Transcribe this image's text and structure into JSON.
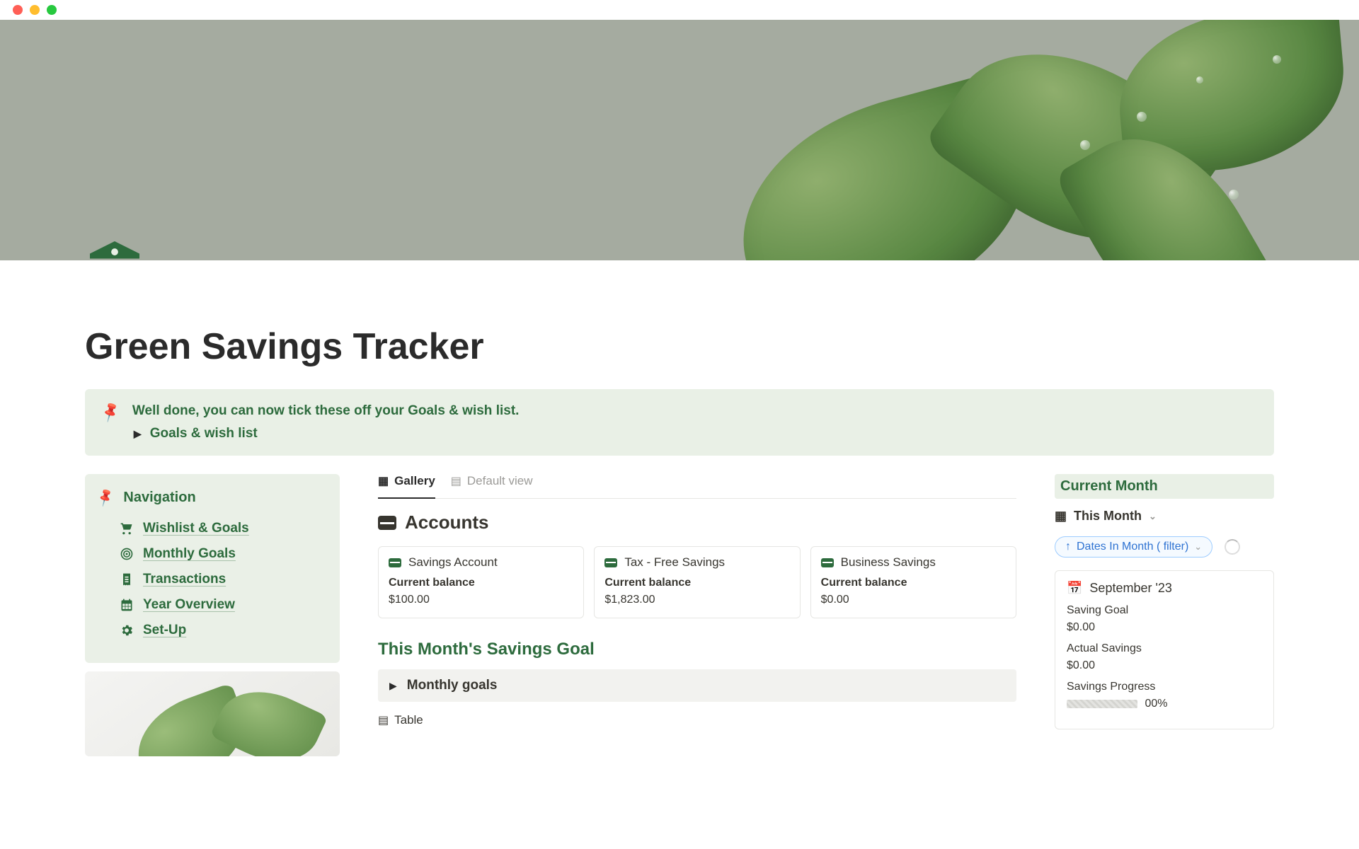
{
  "page": {
    "title": "Green Savings Tracker"
  },
  "callout": {
    "message": "Well done, you can now tick these off your Goals & wish list.",
    "toggle_label": "Goals & wish list"
  },
  "nav": {
    "title": "Navigation",
    "items": [
      {
        "icon": "cart",
        "label": "Wishlist & Goals"
      },
      {
        "icon": "target",
        "label": "Monthly Goals"
      },
      {
        "icon": "receipt",
        "label": "Transactions"
      },
      {
        "icon": "calendar-grid",
        "label": "Year Overview"
      },
      {
        "icon": "gear",
        "label": "Set-Up"
      }
    ]
  },
  "center": {
    "tabs": [
      {
        "icon": "gallery",
        "label": "Gallery",
        "active": true
      },
      {
        "icon": "table",
        "label": "Default view",
        "active": false
      }
    ],
    "accounts_heading": "Accounts",
    "accounts": [
      {
        "name": "Savings Account",
        "sub": "Current balance",
        "balance": "$100.00"
      },
      {
        "name": "Tax - Free Savings",
        "sub": "Current balance",
        "balance": "$1,823.00"
      },
      {
        "name": "Business Savings",
        "sub": "Current balance",
        "balance": "$0.00"
      }
    ],
    "monthly_heading": "This Month's Savings Goal",
    "monthly_toggle": "Monthly goals",
    "table_tab": "Table"
  },
  "right": {
    "heading": "Current Month",
    "view_label": "This Month",
    "filter_label": "Dates In Month ( filter)",
    "month_card": {
      "month": "September '23",
      "rows": [
        {
          "k": "Saving Goal",
          "v": "$0.00"
        },
        {
          "k": "Actual Savings",
          "v": "$0.00"
        },
        {
          "k": "Savings Progress",
          "v": "00%"
        }
      ]
    }
  }
}
